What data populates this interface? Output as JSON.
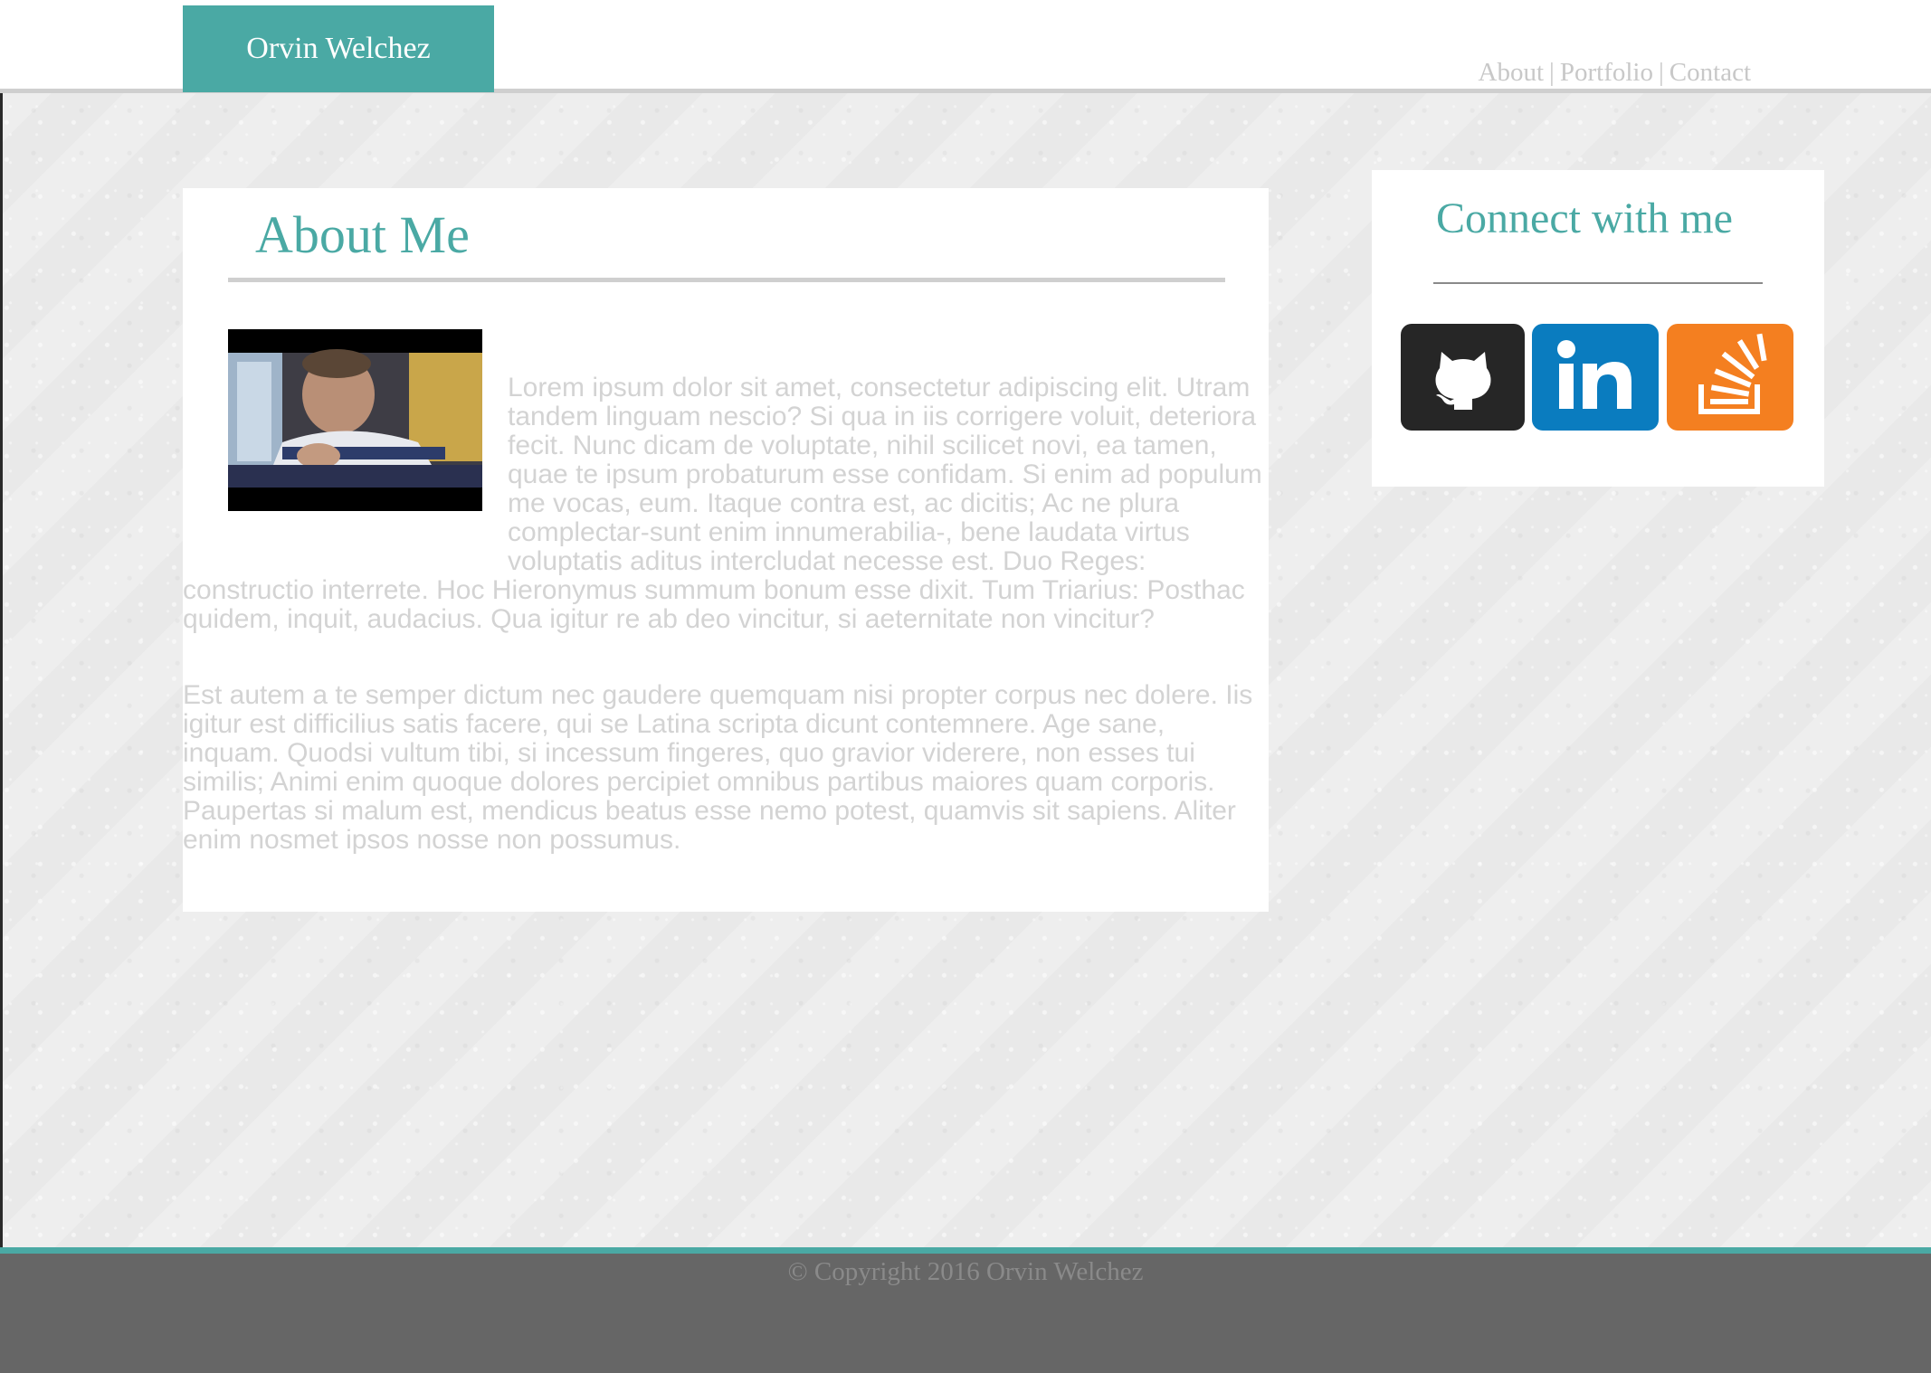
{
  "header": {
    "brand": "Orvin Welchez",
    "nav": {
      "about": "About",
      "portfolio": "Portfolio",
      "contact": "Contact",
      "separator": "|"
    }
  },
  "about": {
    "title": "About Me",
    "paragraphs": [
      "Lorem ipsum dolor sit amet, consectetur adipiscing elit. Utram tandem linguam nescio? Si qua in iis corrigere voluit, deteriora fecit. Nunc dicam de voluptate, nihil scilicet novi, ea tamen, quae te ipsum probaturum esse confidam. Si enim ad populum me vocas, eum. Itaque contra est, ac dicitis; Ac ne plura complectar-sunt enim innumerabilia-, bene laudata virtus voluptatis aditus intercludat necesse est. Duo Reges: constructio interrete. Hoc Hieronymus summum bonum esse dixit. Tum Triarius: Posthac quidem, inquit, audacius. Qua igitur re ab deo vincitur, si aeternitate non vincitur?",
      "Est autem a te semper dictum nec gaudere quemquam nisi propter corpus nec dolere. Iis igitur est difficilius satis facere, qui se Latina scripta dicunt contemnere. Age sane, inquam. Quodsi vultum tibi, si incessum fingeres, quo gravior viderere, non esses tui similis; Animi enim quoque dolores percipiet omnibus partibus maiores quam corporis. Paupertas si malum est, mendicus beatus esse nemo potest, quamvis sit sapiens. Aliter enim nosmet ipsos nosse non possumus."
    ]
  },
  "connect": {
    "title": "Connect with me",
    "links": [
      {
        "name": "GitHub",
        "icon": "github-icon",
        "color": "#262626"
      },
      {
        "name": "LinkedIn",
        "icon": "linkedin-icon",
        "color": "#0a7cbf"
      },
      {
        "name": "Stack Overflow",
        "icon": "stackoverflow-icon",
        "color": "#f47f20"
      }
    ]
  },
  "footer": {
    "copyright": "© Copyright 2016 Orvin Welchez"
  },
  "colors": {
    "accent": "#4aa9a4",
    "footer": "#666666",
    "text_muted": "#d3d3d3"
  }
}
